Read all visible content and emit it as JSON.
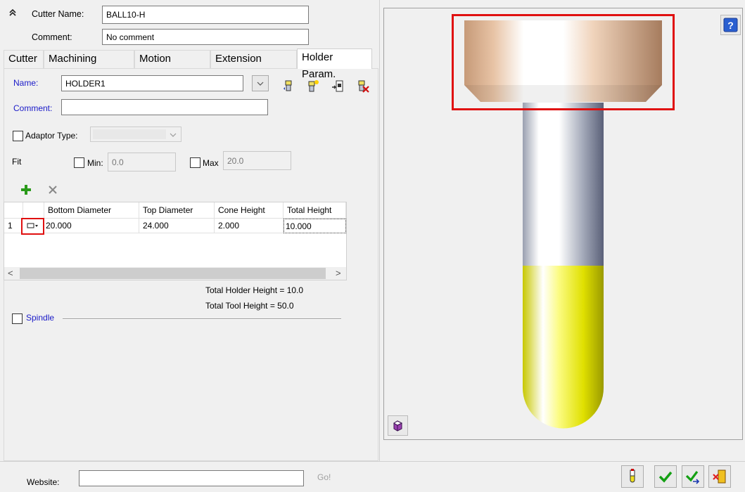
{
  "header": {
    "collapse_icon": "double-chevron-up-icon",
    "cutter_name_label": "Cutter Name:",
    "cutter_name_value": "BALL10-H",
    "comment_label": "Comment:",
    "comment_value": "No comment"
  },
  "tabs": [
    {
      "label": "Cutter",
      "active": false
    },
    {
      "label": "Machining Param.",
      "active": false
    },
    {
      "label": "Motion Param.",
      "active": false
    },
    {
      "label": "Extension Param.",
      "active": false
    },
    {
      "label": "Holder Param.",
      "active": true
    }
  ],
  "holder": {
    "name_label": "Name:",
    "name_value": "HOLDER1",
    "comment_label": "Comment:",
    "comment_value": "",
    "toolbar_icons": [
      "add-holder-icon",
      "new-holder-icon",
      "load-holder-icon",
      "delete-holder-icon"
    ],
    "adaptor_label": "Adaptor Type:",
    "adaptor_value": "",
    "fit_label": "Fit",
    "min_label": "Min:",
    "min_value": "0.0",
    "max_label": "Max",
    "max_value": "20.0"
  },
  "grid": {
    "add_icon": "plus-icon",
    "remove_icon": "x-icon",
    "columns": [
      "Bottom Diameter",
      "Top Diameter",
      "Cone Height",
      "Total Height"
    ],
    "rows": [
      {
        "index": "1",
        "shape_icon": "cone-shape-icon",
        "bottom_diameter": "20.000",
        "top_diameter": "24.000",
        "cone_height": "2.000",
        "total_height": "10.000"
      }
    ],
    "scroll_left": "<",
    "scroll_right": ">"
  },
  "totals": {
    "holder_height": "Total Holder Height = 10.0",
    "tool_height": "Total Tool Height = 50.0"
  },
  "spindle": {
    "label": "Spindle"
  },
  "preview": {
    "help_icon": "question-mark-icon",
    "view_icon": "cube-view-icon",
    "holder_color": "#d9a882",
    "shank_color": "#8d95a8",
    "flute_color": "#e8e820",
    "highlight_color": "#e01010"
  },
  "footer": {
    "website_label": "Website:",
    "website_value": "",
    "go_label": "Go!",
    "buttons": [
      "probe-icon",
      "ok-check-icon",
      "apply-check-icon",
      "exit-icon"
    ]
  }
}
